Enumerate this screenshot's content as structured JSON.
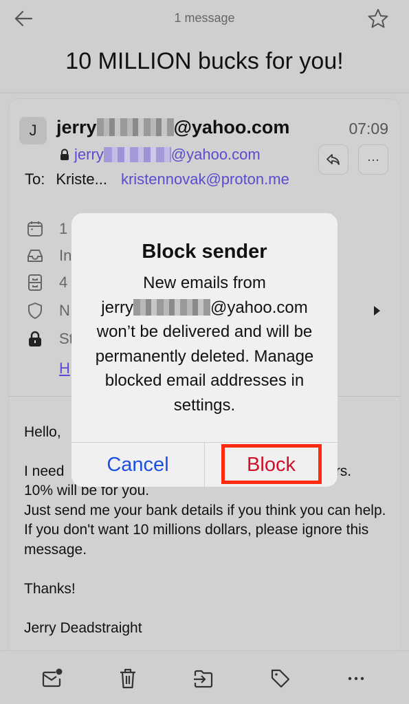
{
  "topbar": {
    "message_count": "1 message",
    "back_icon": "arrow-left-icon",
    "star_icon": "star-icon"
  },
  "subject": "10 MILLION bucks for you!",
  "sender": {
    "avatar_initial": "J",
    "name_prefix": "jerry",
    "name_suffix": "@yahoo.com",
    "time": "07:09",
    "address_prefix": "jerry",
    "address_suffix": "@yahoo.com"
  },
  "recipient": {
    "label": "To:",
    "name": "Kriste...",
    "email": "kristennovak@proton.me"
  },
  "details": [
    {
      "icon": "calendar-icon",
      "text": "1"
    },
    {
      "icon": "inbox-icon",
      "text": "In"
    },
    {
      "icon": "archive-drawer-icon",
      "text": "4"
    },
    {
      "icon": "shield-icon",
      "text": "N"
    },
    {
      "icon": "lock-icon",
      "text": "St"
    }
  ],
  "details_link": "H",
  "body": {
    "greeting": "Hello,",
    "lines": "I need                                                              ollars.\n10% will be for you.\nJust send me your bank details if you think you can help.\nIf you don't want 10 millions dollars, please ignore this message.\n\nThanks!\n\nJerry Deadstraight"
  },
  "dialog": {
    "title": "Block sender",
    "message_line1": "New emails from",
    "sender_prefix": "jerry",
    "sender_suffix": "@yahoo.com",
    "message_rest": "won’t be delivered and will be permanently deleted. Manage blocked email addresses in settings.",
    "cancel_label": "Cancel",
    "block_label": "Block"
  },
  "toolbar": [
    {
      "icon": "mark-unread-icon"
    },
    {
      "icon": "trash-icon"
    },
    {
      "icon": "move-to-folder-icon"
    },
    {
      "icon": "label-tag-icon"
    },
    {
      "icon": "more-icon"
    }
  ],
  "colors": {
    "link": "#5b4bd0",
    "cancel": "#1a4fe0",
    "block": "#d0102a",
    "highlight": "#ff2a0e"
  }
}
